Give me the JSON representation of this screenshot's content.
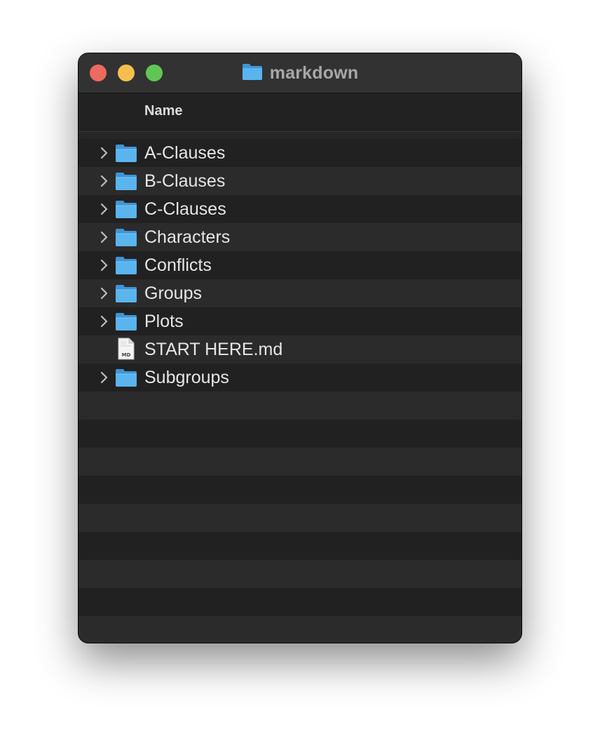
{
  "window": {
    "title": "markdown",
    "title_icon": "folder-icon"
  },
  "header": {
    "name_column": "Name"
  },
  "colors": {
    "folder_blue": "#5ab4ee",
    "close": "#ed6a5e",
    "minimize": "#f5bf4f",
    "maximize": "#61c554"
  },
  "items": [
    {
      "label": "A-Clauses",
      "kind": "folder",
      "icon": "folder-icon"
    },
    {
      "label": "B-Clauses",
      "kind": "folder",
      "icon": "folder-icon"
    },
    {
      "label": "C-Clauses",
      "kind": "folder",
      "icon": "folder-icon"
    },
    {
      "label": "Characters",
      "kind": "folder",
      "icon": "folder-icon"
    },
    {
      "label": "Conflicts",
      "kind": "folder",
      "icon": "folder-icon"
    },
    {
      "label": "Groups",
      "kind": "folder",
      "icon": "folder-icon"
    },
    {
      "label": "Plots",
      "kind": "folder",
      "icon": "folder-icon"
    },
    {
      "label": "START HERE.md",
      "kind": "file",
      "icon": "markdown-file-icon",
      "badge": "MD"
    },
    {
      "label": "Subgroups",
      "kind": "folder",
      "icon": "folder-icon"
    }
  ]
}
